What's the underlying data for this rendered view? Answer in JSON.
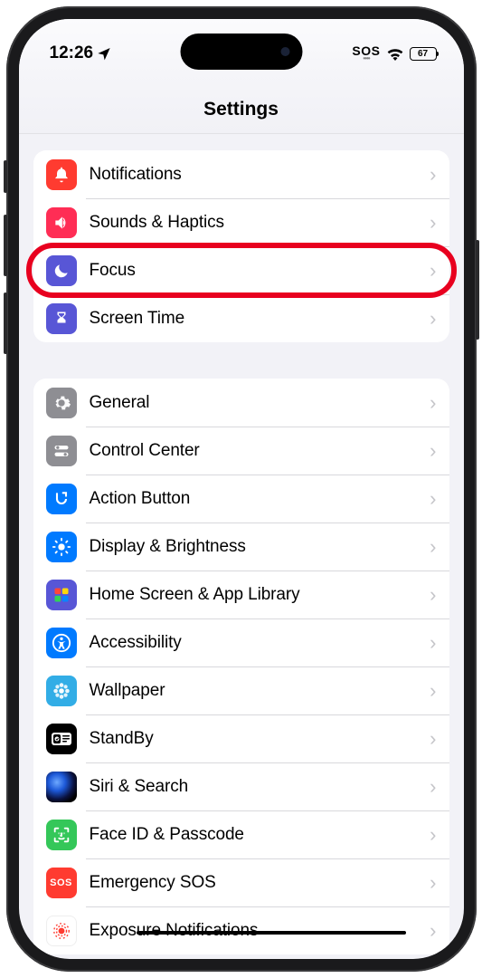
{
  "status": {
    "time": "12:26",
    "sos": "SOS",
    "battery": "67"
  },
  "header": {
    "title": "Settings"
  },
  "group1": [
    {
      "label": "Notifications",
      "icon": "bell-icon",
      "color": "bg-red"
    },
    {
      "label": "Sounds & Haptics",
      "icon": "speaker-icon",
      "color": "bg-pink"
    },
    {
      "label": "Focus",
      "icon": "moon-icon",
      "color": "bg-indigo",
      "highlight": true
    },
    {
      "label": "Screen Time",
      "icon": "hourglass-icon",
      "color": "bg-indigo"
    }
  ],
  "group2": [
    {
      "label": "General",
      "icon": "gear-icon",
      "color": "bg-gray"
    },
    {
      "label": "Control Center",
      "icon": "switches-icon",
      "color": "bg-gray"
    },
    {
      "label": "Action Button",
      "icon": "action-icon",
      "color": "bg-blue"
    },
    {
      "label": "Display & Brightness",
      "icon": "sun-icon",
      "color": "bg-blue"
    },
    {
      "label": "Home Screen & App Library",
      "icon": "grid-icon",
      "color": "bg-grad"
    },
    {
      "label": "Accessibility",
      "icon": "accessibility-icon",
      "color": "bg-blue"
    },
    {
      "label": "Wallpaper",
      "icon": "flower-icon",
      "color": "bg-cyan"
    },
    {
      "label": "StandBy",
      "icon": "standby-icon",
      "color": "bg-black"
    },
    {
      "label": "Siri & Search",
      "icon": "siri-icon",
      "color": "bg-siri"
    },
    {
      "label": "Face ID & Passcode",
      "icon": "faceid-icon",
      "color": "bg-green"
    },
    {
      "label": "Emergency SOS",
      "icon": "sos-icon",
      "color": "bg-red"
    },
    {
      "label": "Exposure Notifications",
      "icon": "exposure-icon",
      "color": "bg-expo"
    }
  ]
}
